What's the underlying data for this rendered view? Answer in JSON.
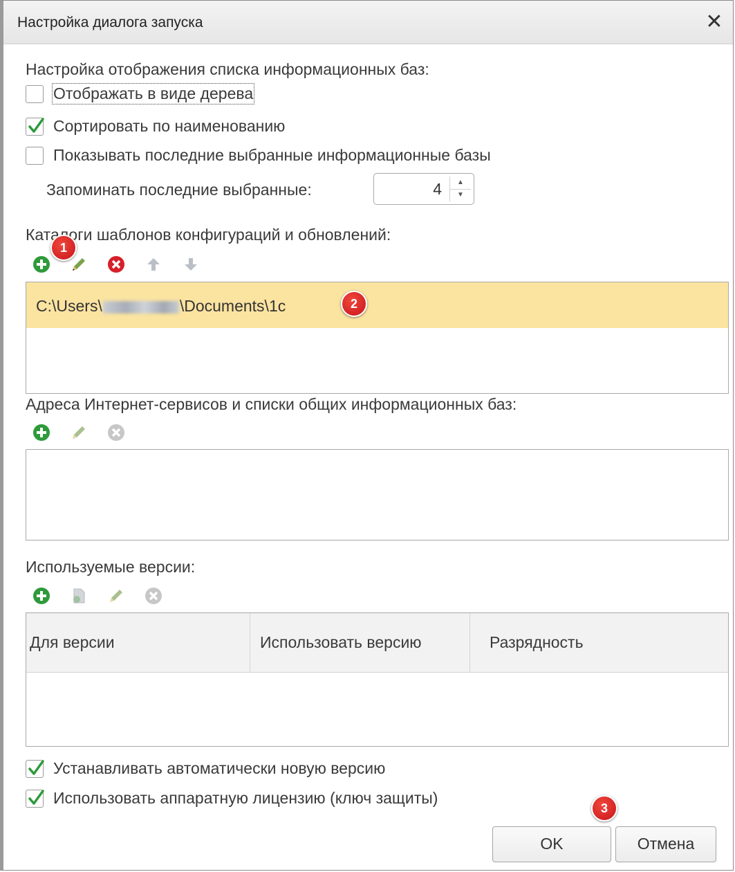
{
  "window": {
    "title": "Настройка диалога запуска",
    "close_label": "✕"
  },
  "display_section": {
    "heading": "Настройка отображения списка информационных баз:",
    "tree_view": {
      "label": "Отображать в виде дерева",
      "checked": false
    },
    "sort_by_name": {
      "label": "Сортировать по наименованию",
      "checked": true
    },
    "show_recent": {
      "label": "Показывать последние выбранные информационные базы",
      "checked": false
    },
    "remember_label": "Запоминать последние выбранные:",
    "remember_value": "4"
  },
  "templates_section": {
    "heading": "Каталоги шаблонов конфигураций и обновлений:",
    "toolbar": [
      "add-icon",
      "edit-icon",
      "delete-icon",
      "move-up-icon",
      "move-down-icon"
    ],
    "items": [
      {
        "prefix": "C:\\Users\\",
        "suffix": "\\Documents\\1c"
      }
    ]
  },
  "internet_section": {
    "heading": "Адреса Интернет-сервисов и списки общих информационных баз:",
    "toolbar": [
      "add-icon",
      "edit-icon",
      "delete-icon"
    ]
  },
  "versions_section": {
    "heading": "Используемые версии:",
    "toolbar": [
      "add-icon",
      "copy-icon",
      "edit-icon",
      "delete-icon"
    ],
    "columns": [
      "Для версии",
      "Использовать версию",
      "Разрядность"
    ]
  },
  "options": {
    "auto_install": {
      "label": "Устанавливать автоматически новую версию",
      "checked": true
    },
    "hardware_license": {
      "label": "Использовать аппаратную лицензию (ключ защиты)",
      "checked": true
    }
  },
  "buttons": {
    "ok": "OK",
    "cancel": "Отмена"
  },
  "annotations": [
    "1",
    "2",
    "3"
  ],
  "colors": {
    "accent_green": "#2e9a3a",
    "delete_red": "#d6202a",
    "selection": "#fbe3a0",
    "badge_red": "#d01a1f"
  }
}
